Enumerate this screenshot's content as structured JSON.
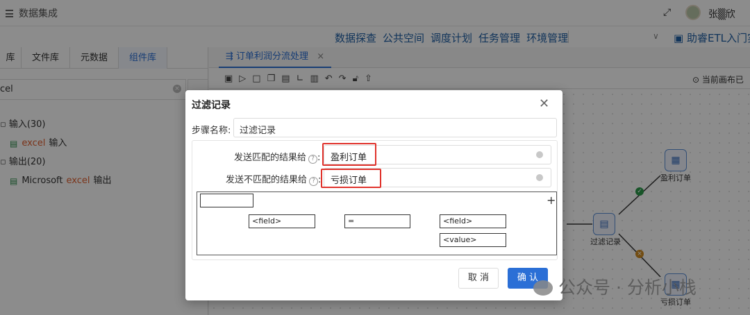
{
  "app": {
    "title": "数据集成",
    "user_name": "张▒欣"
  },
  "nav": {
    "links": [
      "数据探查",
      "公共空间",
      "调度计划",
      "任务管理",
      "环境管理"
    ],
    "help": "助睿ETL入门实"
  },
  "left_panel": {
    "tabs": [
      "库",
      "文件库",
      "元数据",
      "组件库"
    ],
    "search_value": "cel",
    "tree": {
      "input_group": "输入(30)",
      "input_item_kw": "excel",
      "input_item_suffix": "输入",
      "output_group": "输出(20)",
      "output_item_prefix": "Microsoft",
      "output_item_kw": "excel",
      "output_item_suffix": "输出"
    }
  },
  "workspace": {
    "tab_title": "订单利润分流处理",
    "canvas_status": "当前画布已"
  },
  "canvas": {
    "nodes": [
      {
        "label": "盈利订单"
      },
      {
        "label": "过滤记录"
      },
      {
        "label": "亏损订单"
      }
    ]
  },
  "dialog": {
    "title": "过滤记录",
    "step_name_label": "步骤名称:",
    "step_name_value": "过滤记录",
    "match_label": "发送匹配的结果给",
    "match_value": "盈利订单",
    "unmatch_label": "发送不匹配的结果给",
    "unmatch_value": "亏损订单",
    "condition": {
      "field_left": "<field>",
      "operator": "=",
      "field_right": "<field>",
      "value": "<value>"
    },
    "cancel_label": "取 消",
    "confirm_label": "确 认"
  },
  "watermark": "公众号 · 分析小栈",
  "colors": {
    "primary": "#2b6fd6",
    "highlight": "#e0312a",
    "overlay": "rgba(0,0,0,0.45)"
  }
}
